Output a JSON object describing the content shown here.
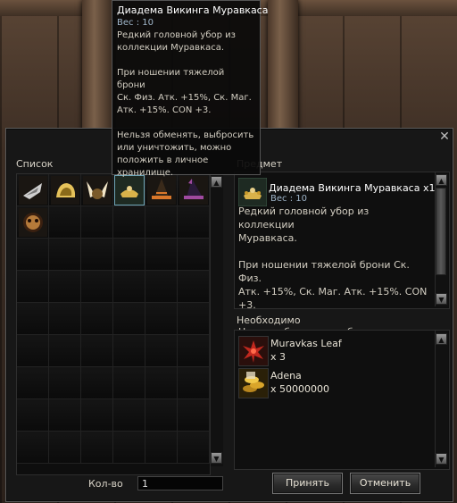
{
  "tooltip": {
    "title": "Диадема Викинга Муравкаса",
    "weight": "Вес : 10",
    "description": "Редкий головной убор из\nколлекции Муравкаса.\n\nПри ношении тяжелой брони\nСк. Физ. Атк. +15%, Ск. Маг.\nАтк. +15%. CON +3.\n\nНельзя обменять, выбросить\nили уничтожить, можно\nположить в личное\nхранилище."
  },
  "window": {
    "list_label": "Список",
    "item_label": "Предмет",
    "required_label": "Необходимо",
    "quantity_label": "Кол-во",
    "quantity_value": "1",
    "accept_label": "Принять",
    "cancel_label": "Отменить"
  },
  "grid": {
    "items": [
      {
        "icon": "fish-fin-icon",
        "colors": [
          "#7a7a7a",
          "#cfcfcf"
        ]
      },
      {
        "icon": "golden-helm-icon",
        "colors": [
          "#8a6a1a",
          "#e6c25a"
        ]
      },
      {
        "icon": "winged-helm-icon",
        "colors": [
          "#7a5a2a",
          "#f2e6c8"
        ]
      },
      {
        "icon": "viking-diadem-icon",
        "colors": [
          "#3a4a3a",
          "#d9b24a"
        ]
      },
      {
        "icon": "witch-hat-orange-icon",
        "colors": [
          "#3a2a1a",
          "#d9772a"
        ]
      },
      {
        "icon": "witch-hat-purple-icon",
        "colors": [
          "#2a1a3a",
          "#a04aa0"
        ]
      },
      {
        "icon": "bronze-mask-icon",
        "colors": [
          "#3a2010",
          "#b57a3a"
        ]
      }
    ],
    "selected_index": 3
  },
  "item_panel": {
    "name": "Диадема Викинга Муравкаса x1",
    "weight": "Вес : 10",
    "description": "Редкий головной убор из коллекции\nМуравкаса.\n\nПри ношении тяжелой брони Ск. Физ.\nАтк. +15%, Ск. Маг. Атк. +15%. CON\n+3.\n\nНельзя обменять, выбросить или"
  },
  "requirements": [
    {
      "name": "Muravkas Leaf",
      "count": "x 3",
      "icon": "red-leaf-icon",
      "color": "#c0281e"
    },
    {
      "name": "Adena",
      "count": "x 50000000",
      "icon": "coins-icon",
      "color": "#d9a52a"
    }
  ]
}
